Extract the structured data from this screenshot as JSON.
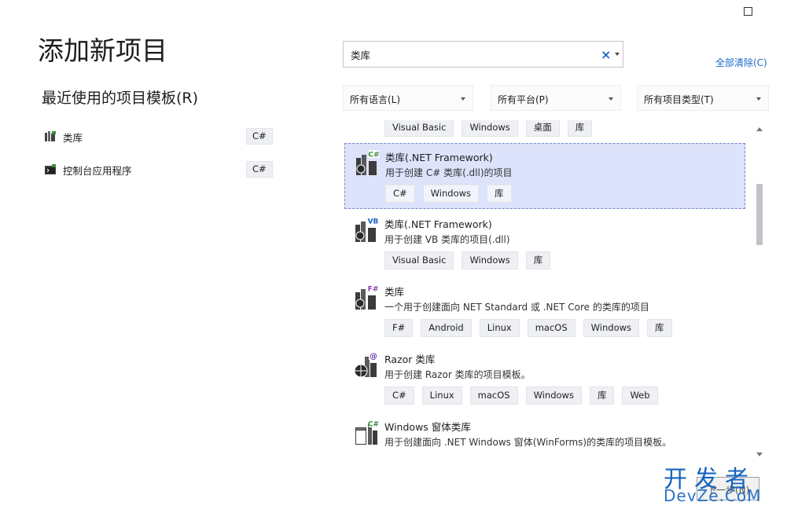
{
  "window": {
    "maximize_icon": "maximize-icon"
  },
  "page": {
    "title": "添加新项目",
    "recent_title": "最近使用的项目模板(R)"
  },
  "recent_templates": [
    {
      "name": "类库",
      "lang": "C#",
      "icon": "class-library-icon"
    },
    {
      "name": "控制台应用程序",
      "lang": "C#",
      "icon": "console-app-icon"
    }
  ],
  "search": {
    "value": "类库",
    "placeholder": "",
    "clear_icon": "×"
  },
  "clear_all": "全部清除(C)",
  "filters": {
    "language": "所有语言(L)",
    "platform": "所有平台(P)",
    "project_type": "所有项目类型(T)"
  },
  "results": {
    "partial_tags": [
      "Visual Basic",
      "Windows",
      "桌面",
      "库"
    ],
    "items": [
      {
        "title": "类库(.NET Framework)",
        "description": "用于创建 C# 类库(.dll)的项目",
        "tags": [
          "C#",
          "Windows",
          "库"
        ],
        "lang_badge": "C#",
        "badge_color": "#3a8d3a",
        "selected": true
      },
      {
        "title": "类库(.NET Framework)",
        "description": "用于创建 VB 类库的项目(.dll)",
        "tags": [
          "Visual Basic",
          "Windows",
          "库"
        ],
        "lang_badge": "VB",
        "badge_color": "#1f5fbf",
        "selected": false
      },
      {
        "title": "类库",
        "description": "一个用于创建面向 NET Standard 或 .NET Core 的类库的项目",
        "tags": [
          "F#",
          "Android",
          "Linux",
          "macOS",
          "Windows",
          "库"
        ],
        "lang_badge": "F#",
        "badge_color": "#8a3fb5",
        "selected": false
      },
      {
        "title": "Razor 类库",
        "description": "用于创建 Razor 类库的项目模板。",
        "tags": [
          "C#",
          "Linux",
          "macOS",
          "Windows",
          "库",
          "Web"
        ],
        "lang_badge": "@",
        "badge_color": "#6a3fb5",
        "selected": false
      },
      {
        "title": "Windows 窗体类库",
        "description": "用于创建面向 .NET Windows 窗体(WinForms)的类库的项目模板。",
        "tags": [],
        "lang_badge": "C#",
        "badge_color": "#3a8d3a",
        "selected": false
      }
    ]
  },
  "next_button": "下一步(N)",
  "watermark": {
    "line1": "开发者",
    "line2": "DevZe.CoM"
  }
}
